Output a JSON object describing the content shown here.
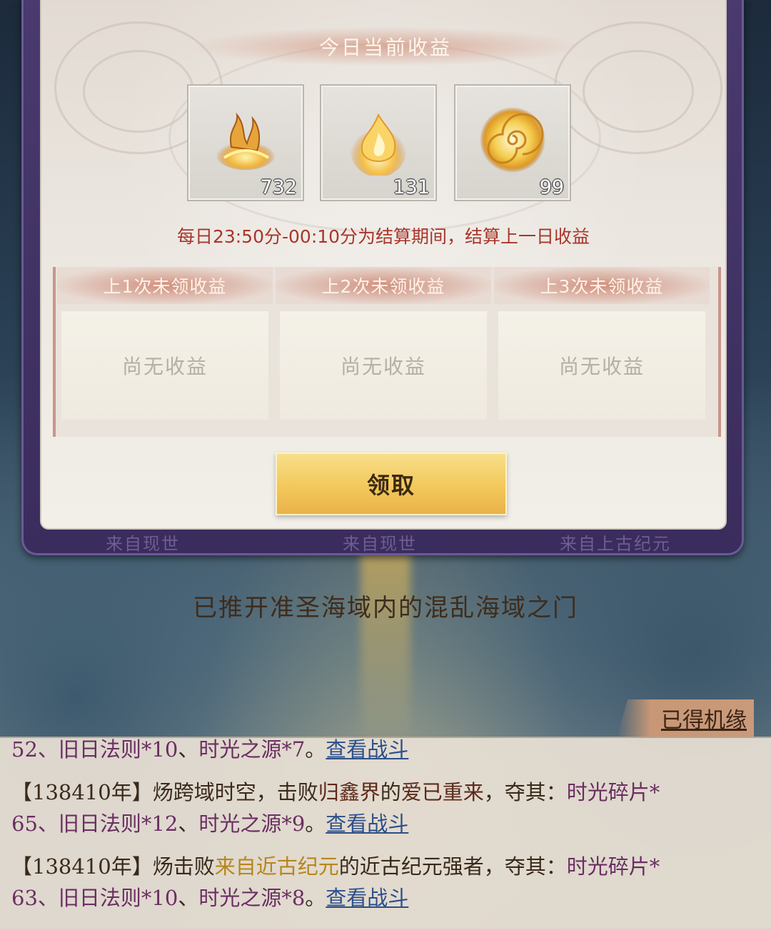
{
  "panel": {
    "title": "今日当前收益",
    "items": [
      {
        "icon": "golden-flame-law-icon",
        "count": "732"
      },
      {
        "icon": "golden-fire-icon",
        "count": "131"
      },
      {
        "icon": "golden-vortex-icon",
        "count": "99"
      }
    ],
    "settle_note": "每日23:50分-00:10分为结算期间，结算上一日收益",
    "pending": [
      {
        "header": "上1次未领收益",
        "empty": "尚无收益"
      },
      {
        "header": "上2次未领收益",
        "empty": "尚无收益"
      },
      {
        "header": "上3次未领收益",
        "empty": "尚无收益"
      }
    ],
    "claim_label": "领取"
  },
  "frame_tabs": [
    "来自现世",
    "来自现世",
    "来自上古纪元"
  ],
  "status_text": "已推开准圣海域内的混乱海域之门",
  "acquired_label": "已得机缘",
  "log": {
    "line0": {
      "a": "52、",
      "b": "旧日法则*10",
      "c": "、",
      "d": "时光之源*7",
      "e": "。",
      "link": "查看战斗"
    },
    "line1": {
      "a": "【138410年】炀跨域时空，击败",
      "b": "归鑫界",
      "c": "的",
      "d": "爱已重来",
      "e": "，夺其：",
      "f": "时光碎片*"
    },
    "line2": {
      "a": "65、",
      "b": "旧日法则*12",
      "c": "、",
      "d": "时光之源*9",
      "e": "。",
      "link": "查看战斗"
    },
    "line3": {
      "a": "【138410年】炀击败",
      "b": "来自近古纪元",
      "c": "的近古纪元强者，夺其：",
      "d": "时光碎片*"
    },
    "line4": {
      "a": "63、",
      "b": "旧日法则*10",
      "c": "、",
      "d": "时光之源*8",
      "e": "。",
      "link": "查看战斗"
    }
  },
  "colors": {
    "accent_red": "#a8362a",
    "button_gold": "#f3c85a",
    "frame_purple": "#4a3a6f",
    "link_blue": "#2b4f8a"
  }
}
